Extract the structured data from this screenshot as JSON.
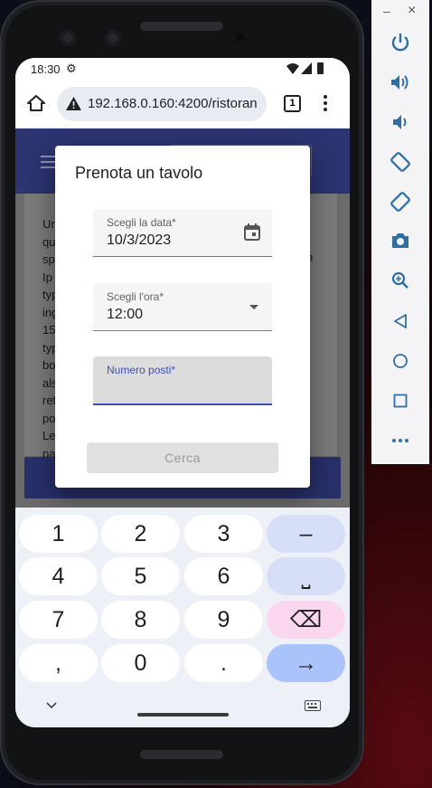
{
  "status_bar": {
    "time": "18:30"
  },
  "browser": {
    "url": "192.168.0.160:4200/ristoran",
    "tab_count": "1"
  },
  "page": {
    "text_lines": [
      "Ur",
      "qu",
      "sp",
      "Ip",
      "typ",
      "ing",
      "15",
      "typ",
      "bo",
      "als",
      "ret",
      "po",
      "Le",
      "pa"
    ],
    "text_right_fragment": "n"
  },
  "dialog": {
    "title": "Prenota un tavolo",
    "date_field": {
      "label": "Scegli la data*",
      "value": "10/3/2023"
    },
    "time_field": {
      "label": "Scegli l'ora*",
      "value": "12:00"
    },
    "seats_field": {
      "label": "Numero posti*",
      "value": ""
    },
    "search_button": "Cerca"
  },
  "keyboard": {
    "rows": [
      [
        "1",
        "2",
        "3",
        "–"
      ],
      [
        "4",
        "5",
        "6",
        "⎵"
      ],
      [
        "7",
        "8",
        "9",
        "⌫"
      ],
      [
        ",",
        "0",
        ".",
        "→"
      ]
    ]
  },
  "emulator_panel": {
    "minimize": "–",
    "close": "×",
    "buttons": [
      "power-icon",
      "volume-up-icon",
      "volume-down-icon",
      "rotate-left-icon",
      "rotate-right-icon",
      "camera-icon",
      "zoom-icon",
      "back-icon",
      "home-icon",
      "overview-icon",
      "more-icon"
    ]
  },
  "colors": {
    "app_bar": "#2c3471",
    "accent": "#3f51b5",
    "emulator_icon": "#2f6fa3",
    "key_side": "#d7def7",
    "key_delete": "#fad7ef",
    "key_enter": "#aac3fb"
  }
}
